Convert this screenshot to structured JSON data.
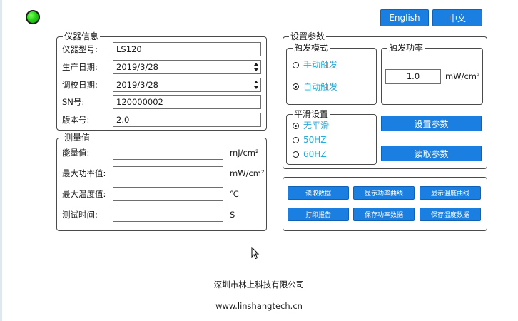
{
  "lang_buttons": {
    "english": "English",
    "chinese": "中文"
  },
  "instrument_info": {
    "title": "仪器信息",
    "model_label": "仪器型号:",
    "model_value": "LS120",
    "prod_date_label": "生产日期:",
    "prod_date_value": "2019/3/28",
    "calib_date_label": "调校日期:",
    "calib_date_value": "2019/3/28",
    "sn_label": "SN号:",
    "sn_value": "120000002",
    "version_label": "版本号:",
    "version_value": "2.0"
  },
  "measurements": {
    "title": "测量值",
    "energy_label": "能量值:",
    "energy_value": "",
    "energy_unit": "mJ/cm²",
    "max_power_label": "最大功率值:",
    "max_power_value": "",
    "max_power_unit": "mW/cm²",
    "max_temp_label": "最大温度值:",
    "max_temp_value": "",
    "max_temp_unit": "℃",
    "test_time_label": "测试时间:",
    "test_time_value": "",
    "test_time_unit": "S"
  },
  "settings": {
    "title": "设置参数",
    "trigger_mode": {
      "title": "触发模式",
      "manual": "手动触发",
      "auto": "自动触发",
      "selected": "auto"
    },
    "trigger_power": {
      "title": "触发功率",
      "value": "1.0",
      "unit": "mW/cm²"
    },
    "smoothing": {
      "title": "平滑设置",
      "none": "无平滑",
      "hz50": "50HZ",
      "hz60": "60HZ",
      "selected": "none"
    },
    "set_button": "设置参数",
    "read_button": "读取参数"
  },
  "actions": {
    "read_data": "读取数据",
    "show_power_curve": "显示功率曲线",
    "show_temp_curve": "显示温度曲线",
    "print_report": "打印报告",
    "save_power_data": "保存功率数据",
    "save_temp_data": "保存温度数据"
  },
  "footer": {
    "company": "深圳市林上科技有限公司",
    "website": "www.linshangtech.cn"
  },
  "colors": {
    "button_blue": "#1a7fe0",
    "radio_text": "#2aa8d8",
    "led_green": "#27d21a"
  }
}
